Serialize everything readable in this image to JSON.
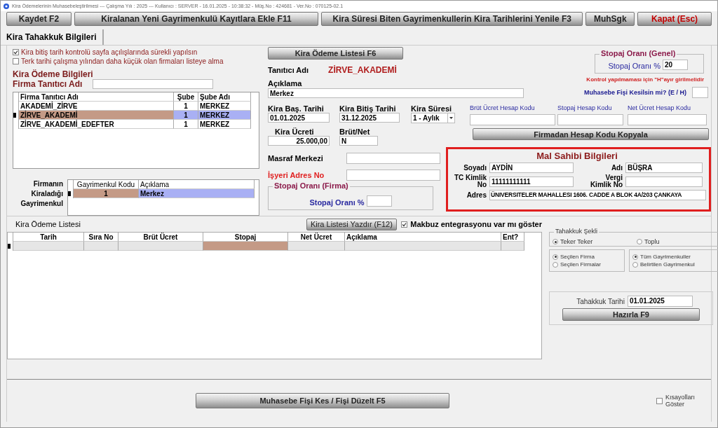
{
  "window": {
    "title": "Kira Ödemelerinin Muhasebeleştirilmesi  ---  Çalışma Yılı : 2025  ---  Kullanıcı : SERVER - 16.01.2025 - 10:38:32 - Müş.No : 424681 - Ver.No : 070125-02.1"
  },
  "toolbar": [
    {
      "label": "Kaydet F2",
      "kind": "normal"
    },
    {
      "label": "Kiralanan Yeni Gayrimenkulü Kayıtlara Ekle F11",
      "kind": "normal"
    },
    {
      "label": "Kira Süresi Biten Gayrimenkullerin Kira Tarihlerini Yenile F3",
      "kind": "normal"
    },
    {
      "label": "MuhSgk",
      "kind": "normal"
    },
    {
      "label": "Kapat (Esc)",
      "kind": "danger"
    }
  ],
  "tabs": [
    {
      "label": "Kira Tahakkuk Bilgileri",
      "selected": true
    }
  ],
  "options": [
    {
      "label": "Kira bitiş tarih kontrolü sayfa açılışlarında sürekli yapılsın",
      "checked": true
    },
    {
      "label": "Terk tarihi çalışma yılından daha küçük olan firmaları listeye alma",
      "checked": false
    }
  ],
  "firm_section": {
    "title": "Kira Ödeme Bilgileri",
    "search_label": "Firma Tanıtıcı Adı"
  },
  "firm_table": {
    "columns": [
      "Firma Tanıtıcı Adı",
      "Şube",
      "Şube Adı"
    ],
    "rows": [
      {
        "cells": [
          "AKADEMİ_ZİRVE",
          "1",
          "MERKEZ"
        ],
        "selected": false
      },
      {
        "cells": [
          "ZİRVE_AKADEMİ",
          "1",
          "MERKEZ"
        ],
        "selected": true
      },
      {
        "cells": [
          "ZİRVE_AKADEMİ_EDEFTER",
          "1",
          "MERKEZ"
        ],
        "selected": false
      }
    ]
  },
  "property_table": {
    "label": "Firmanın Kiraladığı Gayrimenkul",
    "columns": [
      "Gayrimenkul Kodu",
      "Açıklama"
    ],
    "rows": [
      {
        "cells": [
          "1",
          "Merkez"
        ],
        "selected": true
      }
    ]
  },
  "details": {
    "list_button": "Kira Ödeme Listesi F6",
    "identifier_label": "Tanıtıcı Adı",
    "identifier_value": "ZİRVE_AKADEMİ",
    "description_label": "Açıklama",
    "description_value": "Merkez",
    "start_label": "Kira Baş. Tarihi",
    "start_value": "01.01.2025",
    "end_label": "Kira Bitiş Tarihi",
    "end_value": "31.12.2025",
    "period_label": "Kira Süresi",
    "period_value": "1 - Aylık",
    "fee_label": "Kira Ücreti",
    "fee_value": "25.000,00",
    "gross_net_label": "Brüt/Net",
    "gross_net_value": "N",
    "cost_center_label": "Masraf Merkezi",
    "address_no_label": "İşyeri Adres No",
    "firm_withholding": {
      "title": "Stopaj Oranı (Firma)",
      "label": "Stopaj Oranı %"
    }
  },
  "general_withholding": {
    "title": "Stopaj Oranı (Genel)",
    "label": "Stopaj Oranı %",
    "value": "20"
  },
  "warning": "Kontrol yapılmaması için \"H\"ayır girilmelidir",
  "voucher_question": "Muhasebe Fişi Kesilsin mi? (E / H)",
  "account_codes": [
    "Brüt Ücret Hesap Kodu",
    "Stopaj Hesap Kodu",
    "Net Ücret Hesap Kodu"
  ],
  "copy_button": "Firmadan Hesap Kodu Kopyala",
  "owner": {
    "title": "Mal Sahibi Bilgileri",
    "surname_label": "Soyadı",
    "surname": "AYDİN",
    "name_label": "Adı",
    "name": "BÜŞRA",
    "tc_label": "TC Kimlik No",
    "tc": "11111111111",
    "tax_label": "Vergi Kimlik No",
    "address_label": "Adres",
    "address": "ÜNIVERSITELER MAHALLESI 1606. CADDE A BLOK 4A/203 ÇANKAYA"
  },
  "payment_list": {
    "title": "Kira Ödeme Listesi",
    "print_button": "Kira Listesi Yazdır (F12)",
    "receipt_option": {
      "label": "Makbuz entegrasyonu var mı göster",
      "checked": true
    },
    "columns": [
      "Tarih",
      "Sıra No",
      "Brüt Ücret",
      "Stopaj",
      "Net Ücret",
      "Açıklama",
      "Ent?"
    ],
    "rows": [
      {
        "current": true
      }
    ]
  },
  "accrual": {
    "mode_title": "Tahakkuk Şekli",
    "modes": [
      {
        "label": "Teker Teker",
        "selected": true
      },
      {
        "label": "Toplu",
        "selected": false
      }
    ],
    "firm_scope": [
      {
        "label": "Seçilen Firma",
        "selected": true
      },
      {
        "label": "Seçilen Firmalar",
        "selected": false
      }
    ],
    "property_scope": [
      {
        "label": "Tüm Gayrimenkuller",
        "selected": true
      },
      {
        "label": "Belirtilen Gayrimenkul",
        "selected": false
      }
    ],
    "date_label": "Tahakkuk Tarihi",
    "date": "01.01.2025",
    "prepare_button": "Hazırla F9"
  },
  "footer": {
    "voucher_button": "Muhasebe Fişi Kes / Fişi Düzelt F5",
    "shortcuts": {
      "label": "Kısayolları Göster",
      "checked": false
    }
  }
}
